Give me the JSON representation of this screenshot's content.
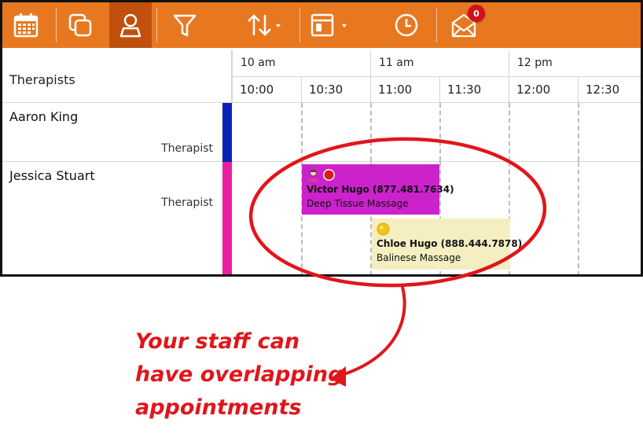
{
  "toolbar": {
    "buttons": [
      {
        "icon": "calendar-icon"
      },
      {
        "icon": "multi-window-icon"
      },
      {
        "icon": "person-icon",
        "active": true
      },
      {
        "icon": "filter-icon"
      },
      {
        "icon": "sort-icon"
      },
      {
        "icon": "layout-icon"
      },
      {
        "icon": "clock-icon"
      },
      {
        "icon": "mail-icon",
        "badge": "0"
      }
    ]
  },
  "schedule": {
    "header_label": "Therapists",
    "hours": [
      "10 am",
      "11 am",
      "12 pm"
    ],
    "slots": [
      "10:00",
      "10:30",
      "11:00",
      "11:30",
      "12:00",
      "12:30"
    ],
    "rows": [
      {
        "name": "Aaron King",
        "role": "Therapist",
        "color": "#0a22b8"
      },
      {
        "name": "Jessica Stuart",
        "role": "Therapist",
        "color": "#ec1ea0"
      }
    ],
    "appointments": [
      {
        "client": "Victor Hugo (877.481.7634)",
        "service": "Deep Tissue Massage",
        "color": "#cc22cc",
        "start": "10:30",
        "end": "11:30",
        "icons": [
          "client-avatar-icon",
          "status-red-icon"
        ]
      },
      {
        "client": "Chloe Hugo (888.444.7878)",
        "service": "Balinese Massage",
        "color": "#f5eec0",
        "start": "11:00",
        "end": "12:00",
        "icons": [
          "status-yellow-icon"
        ]
      }
    ]
  },
  "annotation": {
    "lines": [
      "Your staff can",
      "have overlapping",
      "appointments"
    ],
    "color": "#e0161b"
  }
}
